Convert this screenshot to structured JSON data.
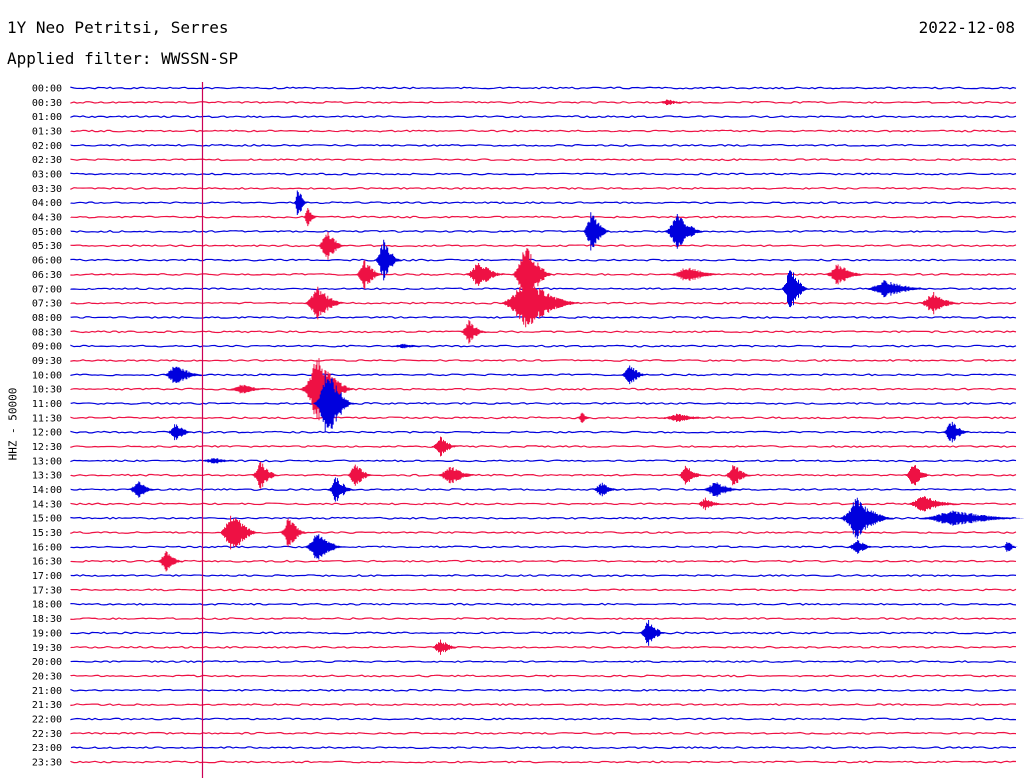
{
  "header": {
    "station": "1Y Neo Petritsi, Serres",
    "date": "2022-12-08",
    "filter": "Applied filter: WWSSN-SP"
  },
  "y_axis_label": "HHZ - 50000",
  "colors": {
    "odd": "#0000dd",
    "even": "#ee1144",
    "marker": "#cc0055"
  },
  "chart_data": {
    "type": "line",
    "title": "1Y Neo Petritsi, Serres",
    "ylabel": "HHZ - 50000",
    "rows": [
      "00:00",
      "00:30",
      "01:00",
      "01:30",
      "02:00",
      "02:30",
      "03:00",
      "03:30",
      "04:00",
      "04:30",
      "05:00",
      "05:30",
      "06:00",
      "06:30",
      "07:00",
      "07:30",
      "08:00",
      "08:30",
      "09:00",
      "09:30",
      "10:00",
      "10:30",
      "11:00",
      "11:30",
      "12:00",
      "12:30",
      "13:00",
      "13:30",
      "14:00",
      "14:30",
      "15:00",
      "15:30",
      "16:00",
      "16:30",
      "17:00",
      "17:30",
      "18:00",
      "18:30",
      "19:00",
      "19:30",
      "20:00",
      "20:30",
      "21:00",
      "21:30",
      "22:00",
      "22:30",
      "23:00",
      "23:30"
    ],
    "row_colors": "alternating blue / red",
    "events": [
      {
        "row": 1,
        "x": 0.63,
        "amp": 0.4,
        "w": 0.02
      },
      {
        "row": 8,
        "x": 0.24,
        "amp": 2.0,
        "w": 0.01
      },
      {
        "row": 9,
        "x": 0.25,
        "amp": 1.4,
        "w": 0.01
      },
      {
        "row": 10,
        "x": 0.55,
        "amp": 2.5,
        "w": 0.02
      },
      {
        "row": 10,
        "x": 0.64,
        "amp": 2.2,
        "w": 0.03
      },
      {
        "row": 11,
        "x": 0.27,
        "amp": 2.0,
        "w": 0.02
      },
      {
        "row": 12,
        "x": 0.33,
        "amp": 2.4,
        "w": 0.02
      },
      {
        "row": 13,
        "x": 0.31,
        "amp": 1.8,
        "w": 0.02
      },
      {
        "row": 13,
        "x": 0.43,
        "amp": 1.6,
        "w": 0.03
      },
      {
        "row": 13,
        "x": 0.48,
        "amp": 4.0,
        "w": 0.03
      },
      {
        "row": 13,
        "x": 0.65,
        "amp": 1.0,
        "w": 0.04
      },
      {
        "row": 13,
        "x": 0.81,
        "amp": 1.3,
        "w": 0.03
      },
      {
        "row": 14,
        "x": 0.76,
        "amp": 3.0,
        "w": 0.02
      },
      {
        "row": 14,
        "x": 0.86,
        "amp": 1.0,
        "w": 0.05
      },
      {
        "row": 15,
        "x": 0.26,
        "amp": 2.0,
        "w": 0.03
      },
      {
        "row": 15,
        "x": 0.48,
        "amp": 3.0,
        "w": 0.06
      },
      {
        "row": 15,
        "x": 0.91,
        "amp": 1.4,
        "w": 0.03
      },
      {
        "row": 17,
        "x": 0.42,
        "amp": 1.4,
        "w": 0.02
      },
      {
        "row": 18,
        "x": 0.35,
        "amp": 0.3,
        "w": 0.03
      },
      {
        "row": 20,
        "x": 0.11,
        "amp": 1.3,
        "w": 0.03
      },
      {
        "row": 20,
        "x": 0.59,
        "amp": 1.3,
        "w": 0.02
      },
      {
        "row": 21,
        "x": 0.26,
        "amp": 4.0,
        "w": 0.04
      },
      {
        "row": 21,
        "x": 0.18,
        "amp": 0.6,
        "w": 0.03
      },
      {
        "row": 22,
        "x": 0.27,
        "amp": 4.5,
        "w": 0.03
      },
      {
        "row": 23,
        "x": 0.54,
        "amp": 0.8,
        "w": 0.01
      },
      {
        "row": 23,
        "x": 0.64,
        "amp": 0.5,
        "w": 0.04
      },
      {
        "row": 24,
        "x": 0.11,
        "amp": 1.1,
        "w": 0.02
      },
      {
        "row": 24,
        "x": 0.93,
        "amp": 1.4,
        "w": 0.02
      },
      {
        "row": 25,
        "x": 0.39,
        "amp": 1.2,
        "w": 0.02
      },
      {
        "row": 26,
        "x": 0.15,
        "amp": 0.4,
        "w": 0.03
      },
      {
        "row": 27,
        "x": 0.2,
        "amp": 1.8,
        "w": 0.02
      },
      {
        "row": 27,
        "x": 0.3,
        "amp": 1.5,
        "w": 0.02
      },
      {
        "row": 27,
        "x": 0.4,
        "amp": 1.2,
        "w": 0.03
      },
      {
        "row": 27,
        "x": 0.65,
        "amp": 1.2,
        "w": 0.02
      },
      {
        "row": 27,
        "x": 0.7,
        "amp": 1.5,
        "w": 0.02
      },
      {
        "row": 27,
        "x": 0.89,
        "amp": 1.5,
        "w": 0.02
      },
      {
        "row": 28,
        "x": 0.07,
        "amp": 1.2,
        "w": 0.02
      },
      {
        "row": 28,
        "x": 0.28,
        "amp": 1.6,
        "w": 0.02
      },
      {
        "row": 28,
        "x": 0.56,
        "amp": 0.9,
        "w": 0.02
      },
      {
        "row": 28,
        "x": 0.68,
        "amp": 1.0,
        "w": 0.03
      },
      {
        "row": 29,
        "x": 0.67,
        "amp": 0.8,
        "w": 0.02
      },
      {
        "row": 29,
        "x": 0.9,
        "amp": 1.0,
        "w": 0.04
      },
      {
        "row": 30,
        "x": 0.83,
        "amp": 2.5,
        "w": 0.04
      },
      {
        "row": 30,
        "x": 0.93,
        "amp": 1.0,
        "w": 0.08
      },
      {
        "row": 31,
        "x": 0.17,
        "amp": 2.5,
        "w": 0.03
      },
      {
        "row": 31,
        "x": 0.23,
        "amp": 2.0,
        "w": 0.02
      },
      {
        "row": 32,
        "x": 0.26,
        "amp": 1.8,
        "w": 0.03
      },
      {
        "row": 32,
        "x": 0.83,
        "amp": 1.0,
        "w": 0.02
      },
      {
        "row": 32,
        "x": 0.99,
        "amp": 0.8,
        "w": 0.01
      },
      {
        "row": 33,
        "x": 0.1,
        "amp": 1.2,
        "w": 0.02
      },
      {
        "row": 38,
        "x": 0.61,
        "amp": 1.6,
        "w": 0.02
      },
      {
        "row": 39,
        "x": 0.39,
        "amp": 1.0,
        "w": 0.02
      }
    ],
    "marker_time_fraction": 0.139
  }
}
